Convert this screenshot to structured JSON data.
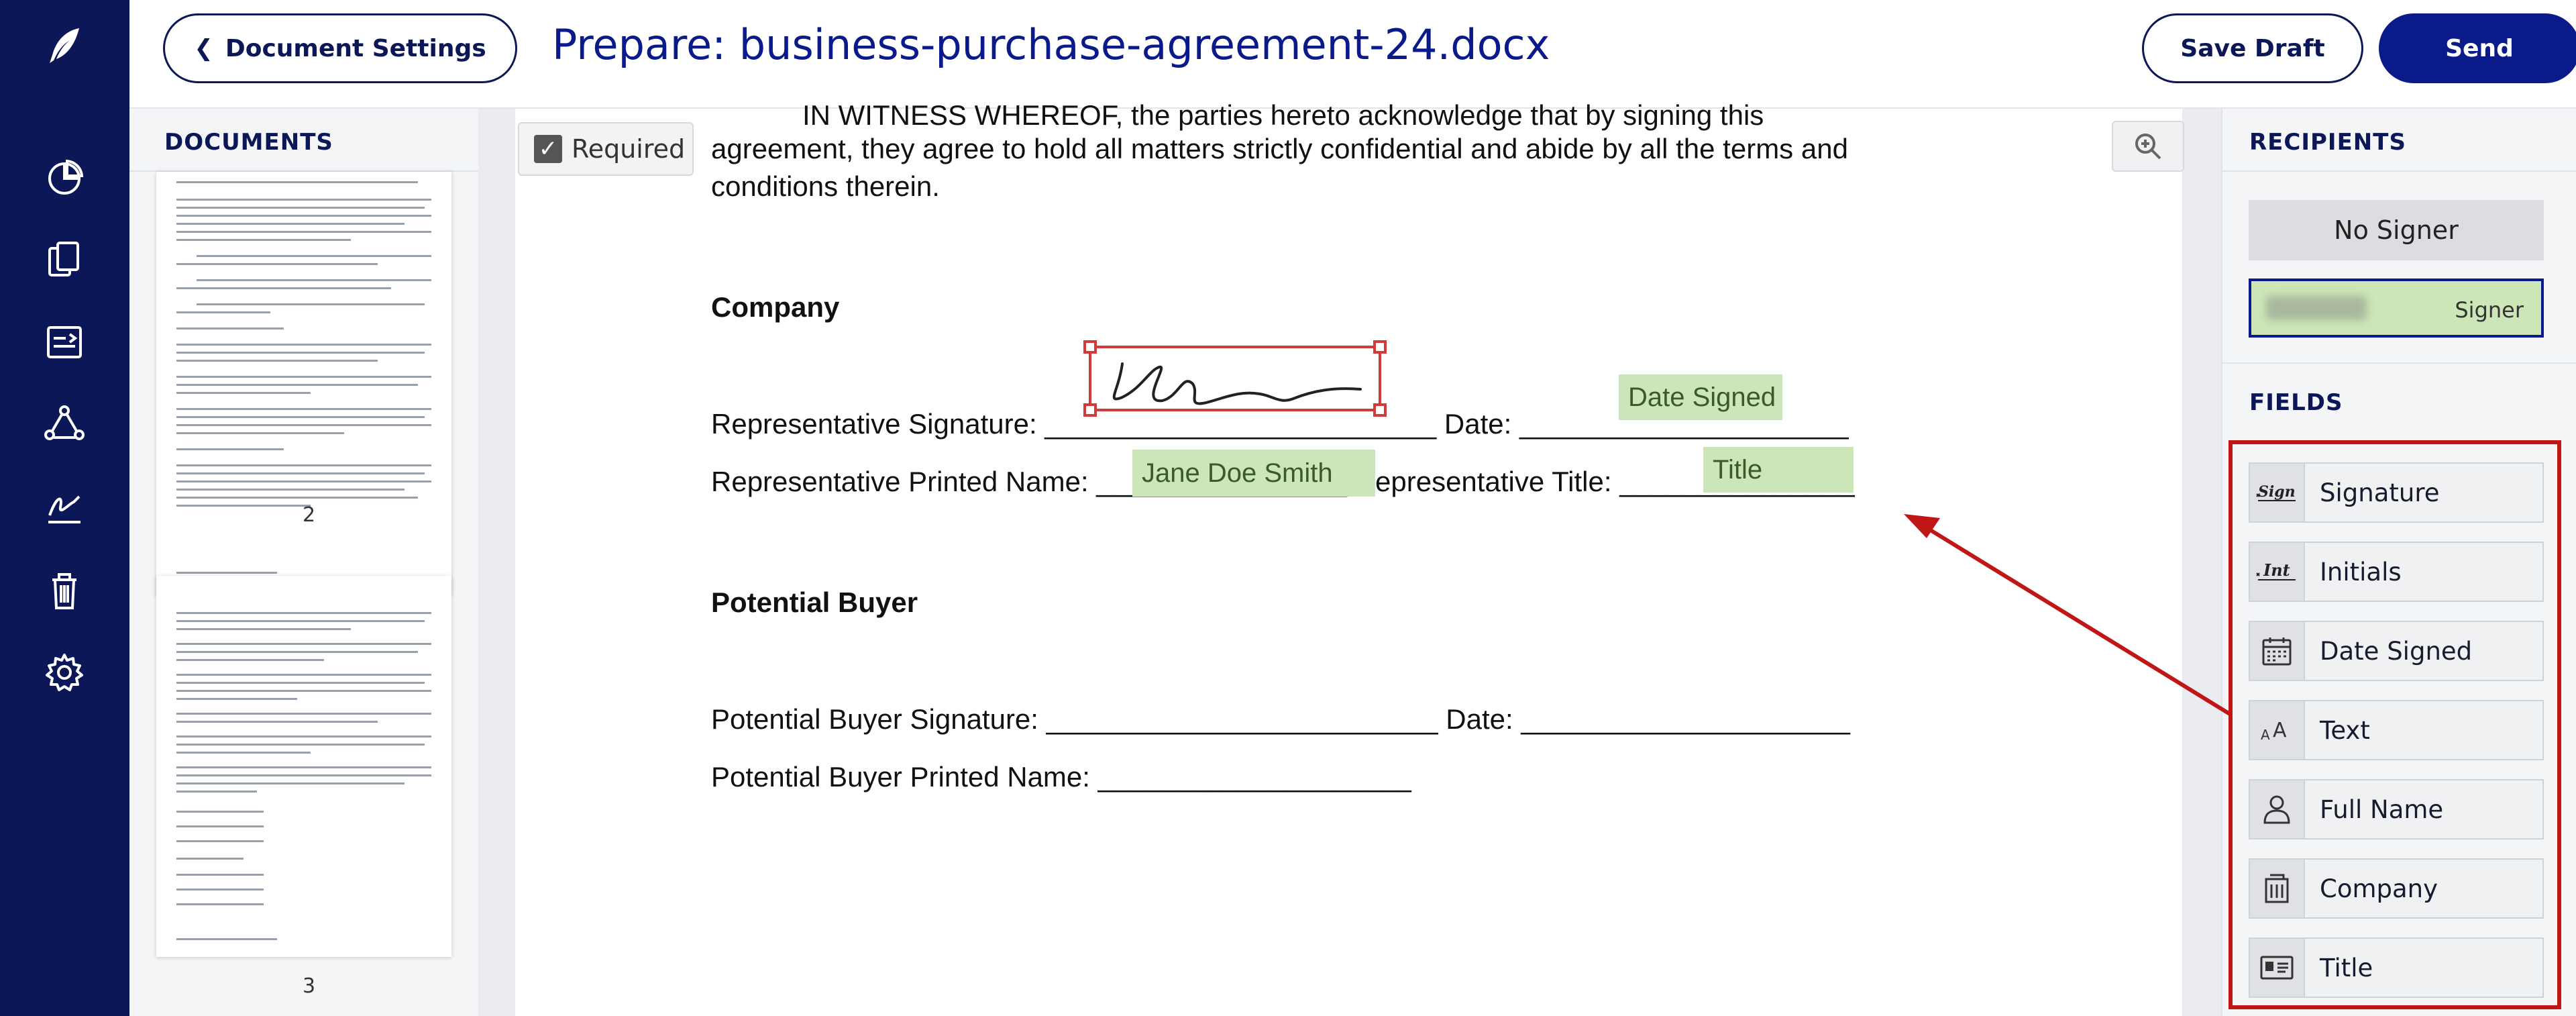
{
  "header": {
    "back_label": "Document Settings",
    "title": "Prepare: business-purchase-agreement-24.docx",
    "save_label": "Save Draft",
    "send_label": "Send"
  },
  "nav": {
    "icons": [
      "quill-logo-icon",
      "pie-chart-icon",
      "documents-icon",
      "template-icon",
      "workflow-icon",
      "sign-icon",
      "trash-icon",
      "gear-icon"
    ]
  },
  "documents": {
    "title": "DOCUMENTS",
    "pages": [
      {
        "number": "2"
      },
      {
        "number": "3"
      }
    ]
  },
  "viewer": {
    "required_label": "Required",
    "lines": {
      "witness_1": "IN WITNESS WHEREOF, the parties hereto acknowledge that by signing this",
      "witness_2": "agreement, they agree to hold all matters strictly confidential and abide by all the terms and",
      "witness_3": "conditions therein.",
      "company_heading": "Company",
      "rep_sig": "Representative Signature: _________________________ Date: _____________________",
      "rep_name": "Representative Printed Name: ________________ Representative Title: _______________",
      "buyer_heading": "Potential Buyer",
      "buyer_sig": "Potential Buyer Signature: _________________________ Date: _____________________",
      "buyer_name": "Potential Buyer Printed Name: ____________________"
    },
    "placed_fields": {
      "date_signed": "Date Signed",
      "printed_name": "Jane Doe Smith",
      "title": "Title"
    }
  },
  "recipients": {
    "title": "RECIPIENTS",
    "no_signer": "No Signer",
    "signer_role": "Signer"
  },
  "fields": {
    "title": "FIELDS",
    "items": [
      {
        "label": "Signature",
        "icon": "signature-icon"
      },
      {
        "label": "Initials",
        "icon": "initials-icon"
      },
      {
        "label": "Date Signed",
        "icon": "calendar-icon"
      },
      {
        "label": "Text",
        "icon": "text-icon"
      },
      {
        "label": "Full Name",
        "icon": "person-icon"
      },
      {
        "label": "Company",
        "icon": "building-icon"
      },
      {
        "label": "Title",
        "icon": "id-card-icon"
      }
    ]
  },
  "colors": {
    "nav_bg": "#0b1757",
    "accent": "#0b1a8a",
    "field_green": "#cde6b7",
    "highlight_red": "#c01616"
  }
}
